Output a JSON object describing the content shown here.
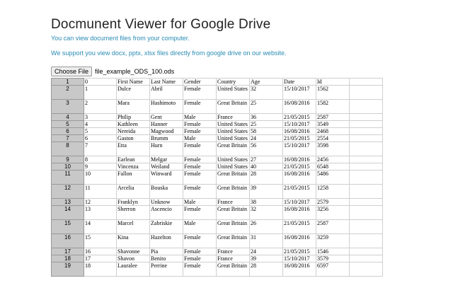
{
  "header": {
    "title": "Docmunent Viewer for Google Drive",
    "line1": "You can view document files from your computer.",
    "line2": "We support you view docx, pptx, xlsx files directly from google drive on our website."
  },
  "uploader": {
    "button_label": "Choose File",
    "file_name": "file_example_ODS_100.ods"
  },
  "sheet": {
    "header": [
      "1",
      "0",
      "First Name",
      "Last Name",
      "Gender",
      "Country",
      "Age",
      "Date",
      "Id",
      ""
    ],
    "rows": [
      [
        "2",
        "1",
        "Dulce",
        "Abril",
        "Female",
        "United States",
        "32",
        "15/10/2017",
        "1562",
        ""
      ],
      [
        "3",
        "2",
        "Mara",
        "Hashimoto",
        "Female",
        "Great Britain",
        "25",
        "16/08/2016",
        "1582",
        ""
      ],
      [
        "4",
        "3",
        "Philip",
        "Gent",
        "Male",
        "France",
        "36",
        "21/05/2015",
        "2587",
        ""
      ],
      [
        "5",
        "4",
        "Kathleen",
        "Hanner",
        "Female",
        "United States",
        "25",
        "15/10/2017",
        "3549",
        ""
      ],
      [
        "6",
        "5",
        "Nereida",
        "Magwood",
        "Female",
        "United States",
        "58",
        "16/08/2016",
        "2468",
        ""
      ],
      [
        "7",
        "6",
        "Gaston",
        "Brumm",
        "Male",
        "United States",
        "24",
        "21/05/2015",
        "2554",
        ""
      ],
      [
        "8",
        "7",
        "Etta",
        "Hurn",
        "Female",
        "Great Britain",
        "56",
        "15/10/2017",
        "3598",
        ""
      ],
      [
        "9",
        "8",
        "Earlean",
        "Melgar",
        "Female",
        "United States",
        "27",
        "16/08/2016",
        "2456",
        ""
      ],
      [
        "10",
        "9",
        "Vincenza",
        "Weiland",
        "Female",
        "United States",
        "40",
        "21/05/2015",
        "6548",
        ""
      ],
      [
        "11",
        "10",
        "Fallon",
        "Winward",
        "Female",
        "Great Britain",
        "28",
        "16/08/2016",
        "5486",
        ""
      ],
      [
        "12",
        "11",
        "Arcelia",
        "Bouska",
        "Female",
        "Great Britain",
        "39",
        "21/05/2015",
        "1258",
        ""
      ],
      [
        "13",
        "12",
        "Franklyn",
        "Unknow",
        "Male",
        "France",
        "38",
        "15/10/2017",
        "2579",
        ""
      ],
      [
        "14",
        "13",
        "Sherron",
        "Ascencio",
        "Female",
        "Great Britain",
        "32",
        "16/08/2016",
        "3256",
        ""
      ],
      [
        "15",
        "14",
        "Marcel",
        "Zabriskie",
        "Male",
        "Great Britain",
        "26",
        "21/05/2015",
        "2587",
        ""
      ],
      [
        "16",
        "15",
        "Kina",
        "Hazelton",
        "Female",
        "Great Britain",
        "31",
        "16/08/2016",
        "3259",
        ""
      ],
      [
        "17",
        "16",
        "Shavonne",
        "Pia",
        "Female",
        "France",
        "24",
        "21/05/2015",
        "1546",
        ""
      ],
      [
        "18",
        "17",
        "Shavon",
        "Benito",
        "Female",
        "France",
        "39",
        "15/10/2017",
        "3579",
        ""
      ],
      [
        "19",
        "18",
        "Lauralee",
        "Perrine",
        "Female",
        "Great Britain",
        "28",
        "16/08/2016",
        "6597",
        ""
      ]
    ]
  }
}
